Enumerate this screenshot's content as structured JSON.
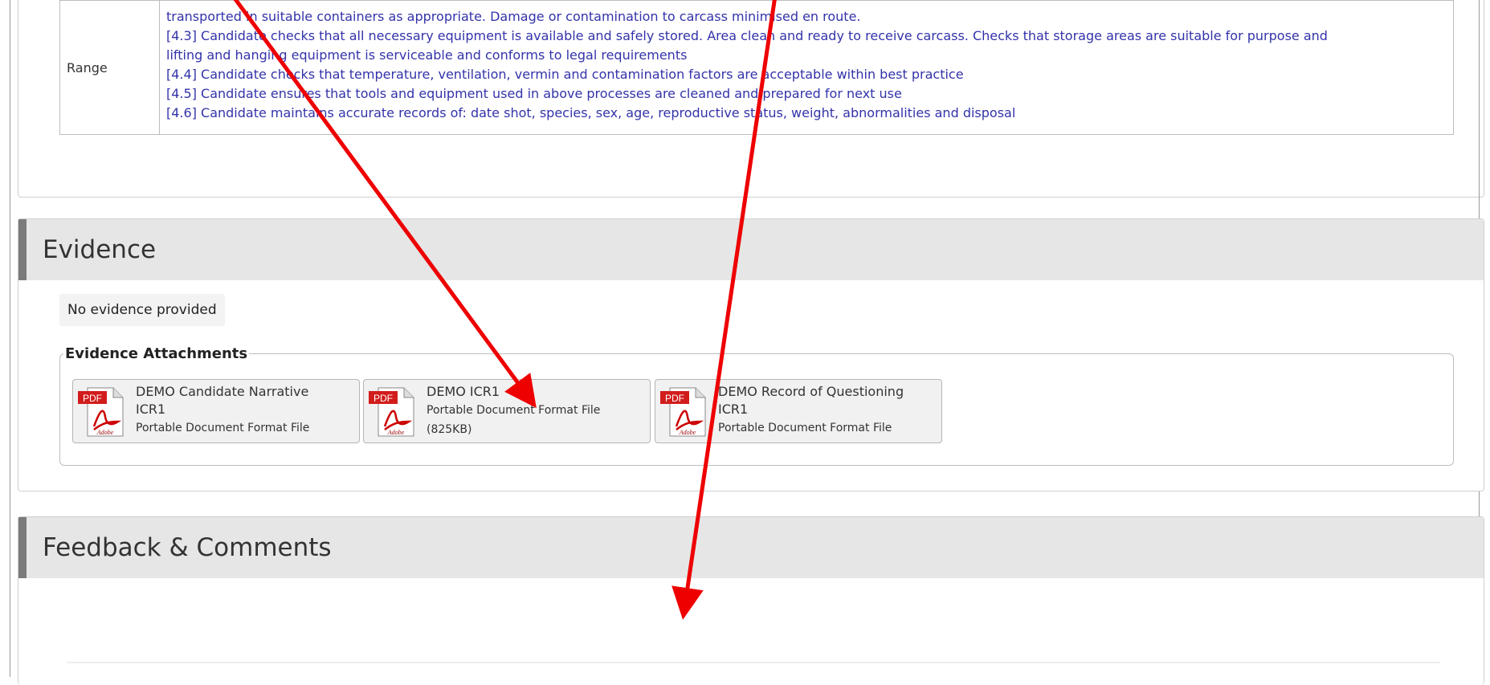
{
  "range": {
    "label": "Range",
    "lines": [
      "transported in suitable containers as appropriate. Damage or contamination to carcass minimised en route.",
      "[4.3] Candidate checks that all necessary equipment is available and safely stored. Area clean and ready to receive carcass. Checks that storage areas are suitable for purpose and",
      "lifting and hanging equipment is serviceable and conforms to legal requirements",
      "[4.4] Candidate checks that temperature, ventilation, vermin and contamination factors are acceptable within best practice",
      "[4.5] Candidate ensures that tools and equipment used in above processes are cleaned and prepared for next use",
      "[4.6] Candidate maintains accurate records of: date shot, species, sex, age, reproductive status, weight, abnormalities and disposal"
    ]
  },
  "evidence": {
    "title": "Evidence",
    "no_evidence": "No evidence provided",
    "attachments_legend": "Evidence Attachments",
    "attachments": [
      {
        "name_line1": "DEMO Candidate Narrative",
        "name_line2": "ICR1",
        "type": "Portable Document Format File",
        "size": ""
      },
      {
        "name_line1": "DEMO ICR1",
        "name_line2": "",
        "type": "Portable Document Format File",
        "size": "(825KB)"
      },
      {
        "name_line1": "DEMO Record of Questioning",
        "name_line2": "ICR1",
        "type": "Portable Document Format File",
        "size": ""
      }
    ]
  },
  "feedback": {
    "title": "Feedback & Comments"
  },
  "icons": {
    "pdf_badge": "PDF",
    "adobe_label": "Adobe"
  },
  "colors": {
    "annotation_arrow": "#ee0000",
    "range_text": "#3333aa",
    "panel_header": "#e6e6e6"
  }
}
